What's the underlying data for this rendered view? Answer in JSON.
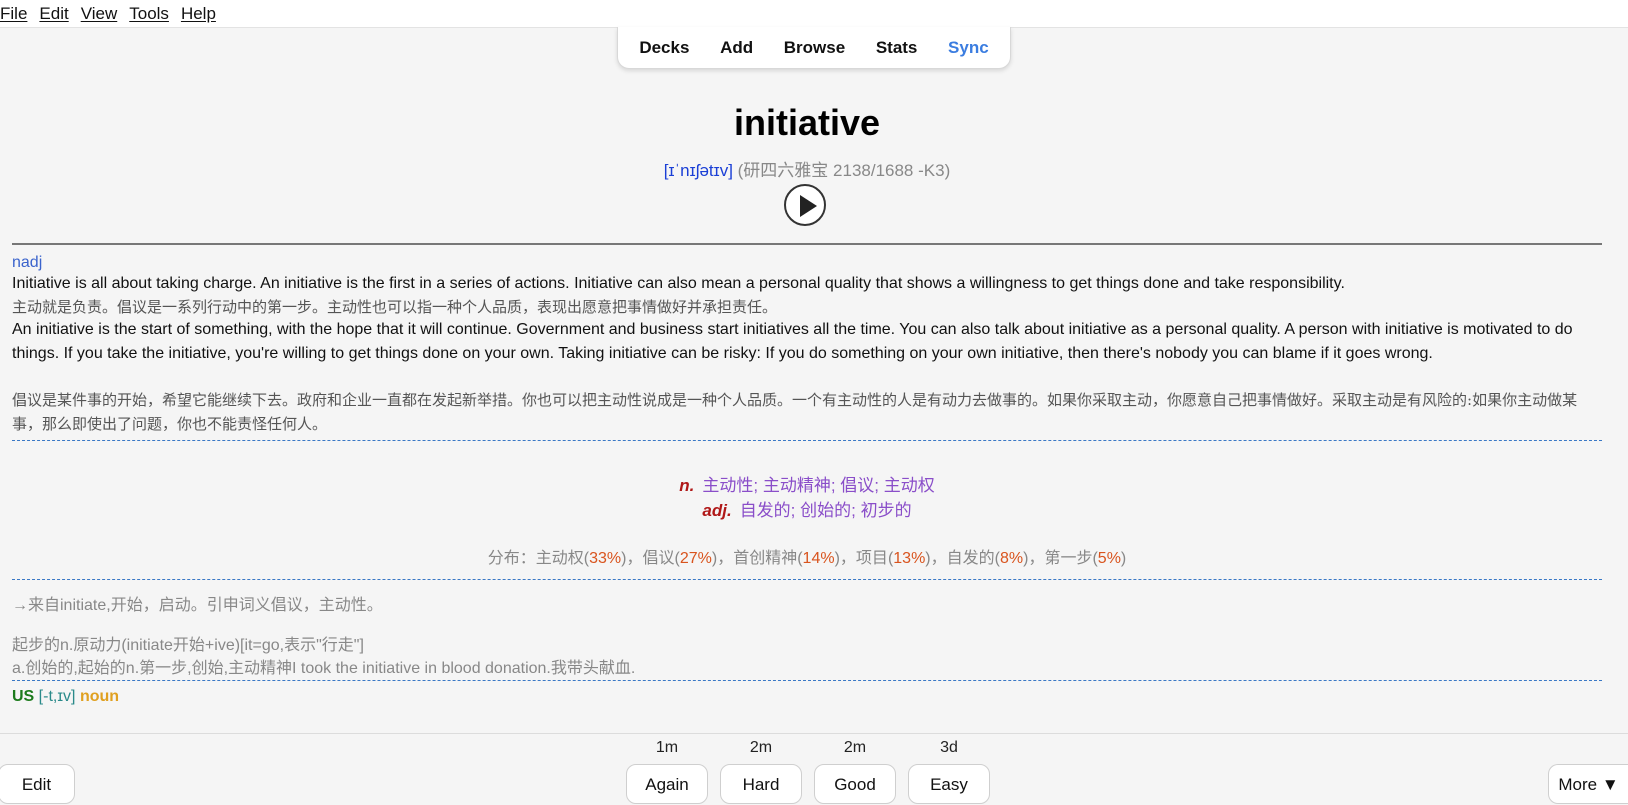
{
  "menu": [
    "File",
    "Edit",
    "View",
    "Tools",
    "Help"
  ],
  "toolbar": {
    "decks": "Decks",
    "add": "Add",
    "browse": "Browse",
    "stats": "Stats",
    "sync": "Sync"
  },
  "card": {
    "word": "initiative",
    "ipa": "[ɪˈnɪʃətɪv]",
    "source": " (研四六雅宝 2138/1688 -K3)",
    "pos_tag": "nadj",
    "paragraphs": [
      "Initiative is all about taking charge. An initiative is the first in a series of actions. Initiative can also mean a personal quality that shows a willingness to get things done and take responsibility.",
      "主动就是负责。倡议是一系列行动中的第一步。主动性也可以指一种个人品质，表现出愿意把事情做好并承担责任。",
      "An initiative is the start of something, with the hope that it will continue. Government and business start initiatives all the time. You can also talk about initiative as a personal quality. A person with initiative is motivated to do things. If you take the initiative, you're willing to get things done on your own. Taking initiative can be risky: If you do something on your own initiative, then there's nobody you can blame if it goes wrong.",
      "倡议是某件事的开始，希望它能继续下去。政府和企业一直都在发起新举措。你也可以把主动性说成是一种个人品质。一个有主动性的人是有动力去做事的。如果你采取主动，你愿意自己把事情做好。采取主动是有风险的:如果你主动做某事，那么即使出了问题，你也不能责怪任何人。"
    ],
    "defs": [
      {
        "pos": "n.",
        "meaning": "主动性; 主动精神; 倡议; 主动权"
      },
      {
        "pos": "adj.",
        "meaning": "自发的; 创始的; 初步的"
      }
    ],
    "dist": {
      "prefix": "分布：",
      "items": [
        {
          "label": "主动权",
          "pct": "33%"
        },
        {
          "label": "倡议",
          "pct": "27%"
        },
        {
          "label": "首创精神",
          "pct": "14%"
        },
        {
          "label": "项目",
          "pct": "13%"
        },
        {
          "label": "自发的",
          "pct": "8%"
        },
        {
          "label": "第一步",
          "pct": "5%"
        }
      ]
    },
    "etym1": "→来自initiate,开始，启动。引申词义倡议，主动性。",
    "etym2": "起步的n.原动力(initiate开始+ive)[it=go,表示\"行走\"]",
    "etym3": "a.创始的,起始的n.第一步,创始,主动精神I took the initiative in blood donation.我带头献血.",
    "us": "US",
    "us_pron": " [-t,ɪv] ",
    "us_pos": "noun"
  },
  "bottom": {
    "edit": "Edit",
    "answers": [
      {
        "timing": "1m",
        "label": "Again"
      },
      {
        "timing": "2m",
        "label": "Hard"
      },
      {
        "timing": "2m",
        "label": "Good"
      },
      {
        "timing": "3d",
        "label": "Easy"
      }
    ],
    "more": "More ▼"
  }
}
